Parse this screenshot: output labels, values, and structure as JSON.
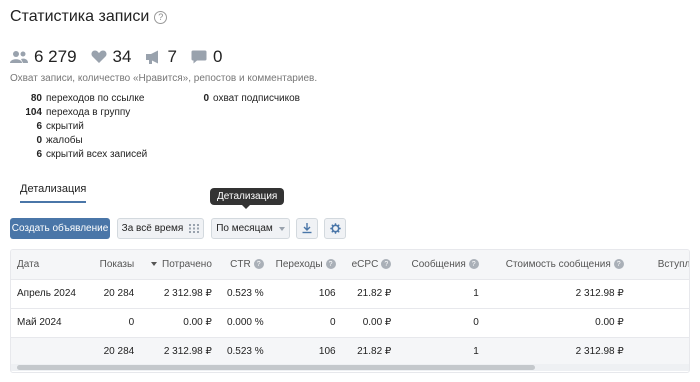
{
  "page": {
    "title": "Статистика записи",
    "help": "?"
  },
  "metrics": [
    {
      "icon": "users-icon",
      "value": "6 279"
    },
    {
      "icon": "heart-icon",
      "value": "34"
    },
    {
      "icon": "megaphone-icon",
      "value": "7"
    },
    {
      "icon": "comment-icon",
      "value": "0"
    }
  ],
  "description": "Охват записи, количество «Нравится», репостов и комментариев.",
  "stats_left": [
    {
      "num": "80",
      "label": "переходов по ссылке"
    },
    {
      "num": "104",
      "label": "перехода в группу"
    },
    {
      "num": "6",
      "label": "скрытий"
    },
    {
      "num": "0",
      "label": "жалобы"
    },
    {
      "num": "6",
      "label": "скрытий всех записей"
    }
  ],
  "stats_right": [
    {
      "num": "0",
      "label": "охват подписчиков"
    }
  ],
  "tabs": {
    "detail": "Детализация"
  },
  "tooltip": "Детализация",
  "toolbar": {
    "create_ad": "Создать объявление",
    "period": "За всё время",
    "grouping": "По месяцам"
  },
  "table": {
    "headers": {
      "date": "Дата",
      "shows": "Показы",
      "spent": "Потрачено",
      "ctr": "CTR",
      "clicks": "Переходы",
      "ecpc": "eCPC",
      "messages": "Сообщения",
      "msg_cost": "Стоимость сообщения",
      "joins": "Вступления"
    },
    "rows": [
      {
        "date": "Апрель 2024",
        "shows": "20 284",
        "spent": "2 312.98 ₽",
        "ctr": "0.523 %",
        "clicks": "106",
        "ecpc": "21.82 ₽",
        "messages": "1",
        "msg_cost": "2 312.98 ₽",
        "joins": ""
      },
      {
        "date": "Май 2024",
        "shows": "0",
        "spent": "0.00 ₽",
        "ctr": "0.000 %",
        "clicks": "0",
        "ecpc": "0.00 ₽",
        "messages": "0",
        "msg_cost": "0.00 ₽",
        "joins": ""
      }
    ],
    "total": {
      "date": "",
      "shows": "20 284",
      "spent": "2 312.98 ₽",
      "ctr": "0.523 %",
      "clicks": "106",
      "ecpc": "21.82 ₽",
      "messages": "1",
      "msg_cost": "2 312.98 ₽",
      "joins": ""
    }
  },
  "colors": {
    "accent": "#4a76a8",
    "icon_gray": "#99a2ad"
  }
}
